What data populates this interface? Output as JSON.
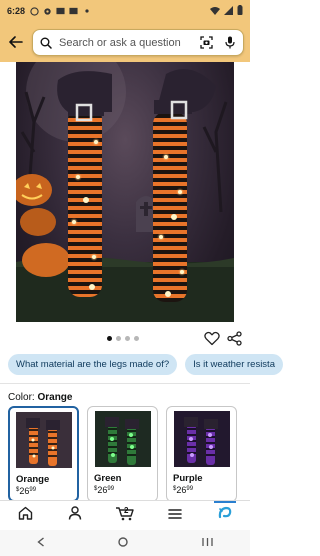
{
  "status_bar": {
    "time": "6:28",
    "icons": [
      "whatsapp-icon",
      "settings-icon",
      "mail-icon",
      "mail-icon",
      "dot-icon"
    ],
    "right_icons": [
      "wifi-icon",
      "signal-icon",
      "battery-icon"
    ]
  },
  "header": {
    "search_placeholder": "Search or ask a question",
    "icons": [
      "back-arrow-icon",
      "search-icon",
      "camera-scan-icon",
      "microphone-icon"
    ]
  },
  "carousel": {
    "dots": 4,
    "active_index": 0
  },
  "question_chips": [
    "What material are the legs made of?",
    "Is it weather resista"
  ],
  "color": {
    "label": "Color:",
    "selected": "Orange"
  },
  "swatches": [
    {
      "name": "Orange",
      "price_symbol": "$",
      "price_whole": "26",
      "price_fraction": "99",
      "selected": true,
      "accent": "#ff8a3d"
    },
    {
      "name": "Green",
      "price_symbol": "$",
      "price_whole": "26",
      "price_fraction": "99",
      "selected": false,
      "accent": "#4fd86a"
    },
    {
      "name": "Purple",
      "price_symbol": "$",
      "price_whole": "26",
      "price_fraction": "99",
      "selected": false,
      "accent": "#a05ce8"
    }
  ],
  "bottom_nav": {
    "items": [
      "home-icon",
      "account-icon",
      "cart-icon",
      "menu-icon",
      "rufus-icon"
    ],
    "cart_count": "2"
  },
  "colors": {
    "header_bg": "#f2c77b",
    "chip_bg": "#cfe5f4",
    "selected_border": "#2162a1"
  }
}
